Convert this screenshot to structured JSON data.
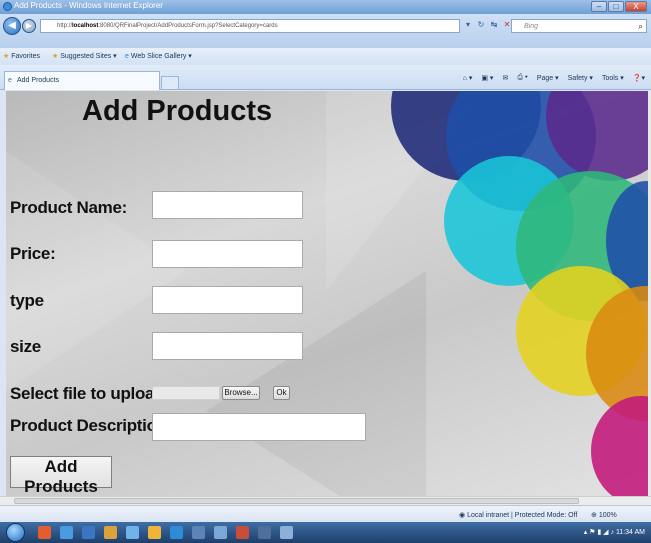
{
  "window": {
    "title": "Add Products - Windows Internet Explorer",
    "min_label": "–",
    "max_label": "□",
    "close_label": "X"
  },
  "address_bar": {
    "url_prefix": "http://",
    "url_host": "localhost",
    "url_rest": ":8080/QRFinalProject/AddProductsForm.jsp?SelectCategory=cards",
    "search_placeholder": "Bing"
  },
  "favorites_bar": {
    "favorites_label": "Favorites",
    "suggested_sites_label": "Suggested Sites ▾",
    "web_slice_label": "Web Slice Gallery ▾"
  },
  "tab": {
    "label": "Add Products"
  },
  "command_bar": {
    "page_label": "Page ▾",
    "safety_label": "Safety ▾",
    "tools_label": "Tools ▾"
  },
  "form": {
    "heading": "Add Products",
    "product_name_label": "Product Name:",
    "product_name_value": "",
    "price_label": "Price:",
    "price_value": "",
    "type_label": "type",
    "type_value": "",
    "size_label": "size",
    "size_value": "",
    "upload_label": "Select file to upload:",
    "browse_label": "Browse...",
    "ok_label": "Ok",
    "description_label": "Product Description:",
    "description_value": "",
    "submit_label": "Add Products"
  },
  "status_bar": {
    "zone_text": "Local intranet | Protected Mode: Off",
    "zoom_text": "100%"
  },
  "taskbar": {
    "clock": "11:34 AM"
  },
  "colors": {
    "circle_navy": "#1e2a78",
    "circle_blue": "#1f4fa8",
    "circle_cyan": "#19c6d8",
    "circle_green": "#2fb77a",
    "circle_yellow": "#e5d21e",
    "circle_orange": "#d98a10",
    "circle_magenta": "#c2187a",
    "circle_purple": "#5a2a8c"
  }
}
